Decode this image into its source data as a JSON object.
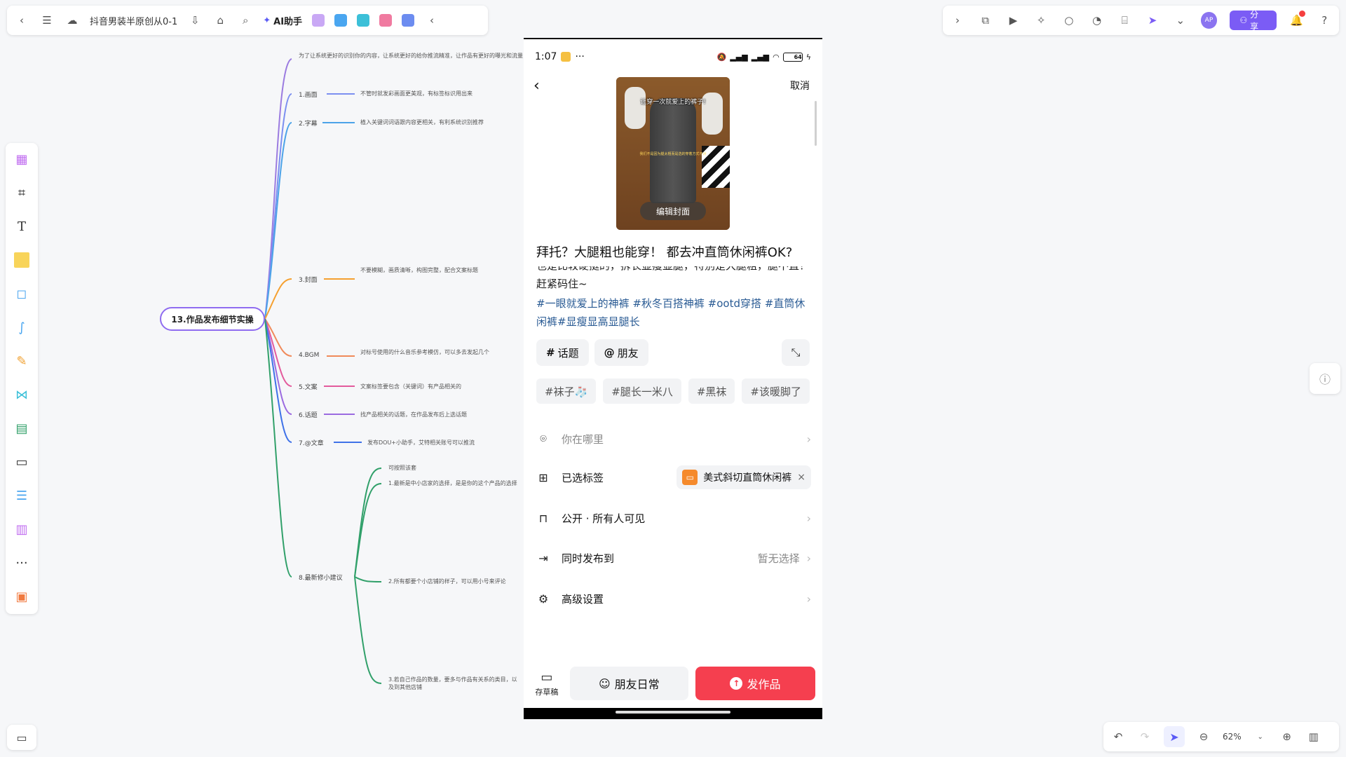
{
  "app": {
    "doc_title": "抖音男装半原创从0-1",
    "ai_label": "AI助手"
  },
  "mindmap": {
    "root": "13.作品发布细节实操",
    "intro": "为了让系统更好的识别你的内容，让系统更好的给你推流精准，让作品有更好的曝光和流量",
    "branches": [
      {
        "label": "1.画面",
        "leaf": "不管时就发彩画面更美观，有标签标识用出来"
      },
      {
        "label": "2.字幕",
        "leaf": "植入关键词词语跟内容更相关，有利系统识别推荐"
      },
      {
        "label": "3.封面",
        "leaf": "不要模糊，画质清晰，构图完整，配合文案标题"
      },
      {
        "label": "4.BGM",
        "leaf": "对标号使用的什么音乐参考模仿，可以多去发起几个"
      },
      {
        "label": "5.文案",
        "leaf": "文案标签要包含（关键词）有产品相关的"
      },
      {
        "label": "6.话题",
        "leaf": "找产品相关的话题，在作品发布后上选话题"
      },
      {
        "label": "7.@文章",
        "leaf": "发布DOU+小助手，艾特相关账号可以推流"
      },
      {
        "label": "8.最新修小建议",
        "leaf": "可按照该套"
      }
    ],
    "sub_leaves": [
      "1.最新是中小店家的选择，是是你的这个产品的选择",
      "2.所有都要个小店铺的样子，可以用小号来评论",
      "3.若自己作品的数量，要多与作品有关系的类目，以及到其他店铺"
    ]
  },
  "left_toolbar": {
    "tools": [
      "template-icon",
      "frame-icon",
      "text-icon",
      "sticky-note-icon",
      "shape-icon",
      "connector-icon",
      "pen-icon",
      "mindmap-icon",
      "table-icon",
      "doc-icon",
      "list-icon",
      "kanban-icon",
      "more-icon",
      "apps-icon"
    ],
    "text_tool_glyph": "T",
    "more_glyph": "···"
  },
  "top_right": {
    "avatar_text": "AP",
    "share_label": "分享"
  },
  "zoom": {
    "level": "62%"
  },
  "phone": {
    "status": {
      "time": "1:07",
      "dots": "···",
      "battery": "64"
    },
    "cancel_label": "取消",
    "cover": {
      "caption": "让穿一次就爱上的裤子!",
      "small_text": "我们不是因为腿太粗而是选的穿着方式不对",
      "edit_label": "编辑封面"
    },
    "title": "拜托？大腿粗也能穿！ 都去冲直筒休闲裤OK?",
    "body": "也是比较硬挺的，拆长显瘦显腿，特别是大腿粗，腿不直！赶紧码住~",
    "hashtags": "#一眼就爱上的神裤 #秋冬百搭神裤 #ootd穿搭 #直筒休闲裤#显瘦显高显腿长",
    "chips": {
      "topic_icon": "#",
      "topic": "话题",
      "friend_icon": "@",
      "friend": "朋友"
    },
    "tags": [
      "#袜子🧦",
      "#腿长一米八",
      "#黑袜",
      "#该暖脚了"
    ],
    "settings": {
      "location": "你在哪里",
      "selected_tags": "已选标签",
      "tag_pill": "美式斜切直筒休闲裤",
      "visibility": "公开 · 所有人可见",
      "sync_publish": "同时发布到",
      "sync_value": "暂无选择",
      "advanced": "高级设置"
    },
    "bottom": {
      "draft": "存草稿",
      "friends_daily": "朋友日常",
      "publish": "发作品"
    }
  }
}
